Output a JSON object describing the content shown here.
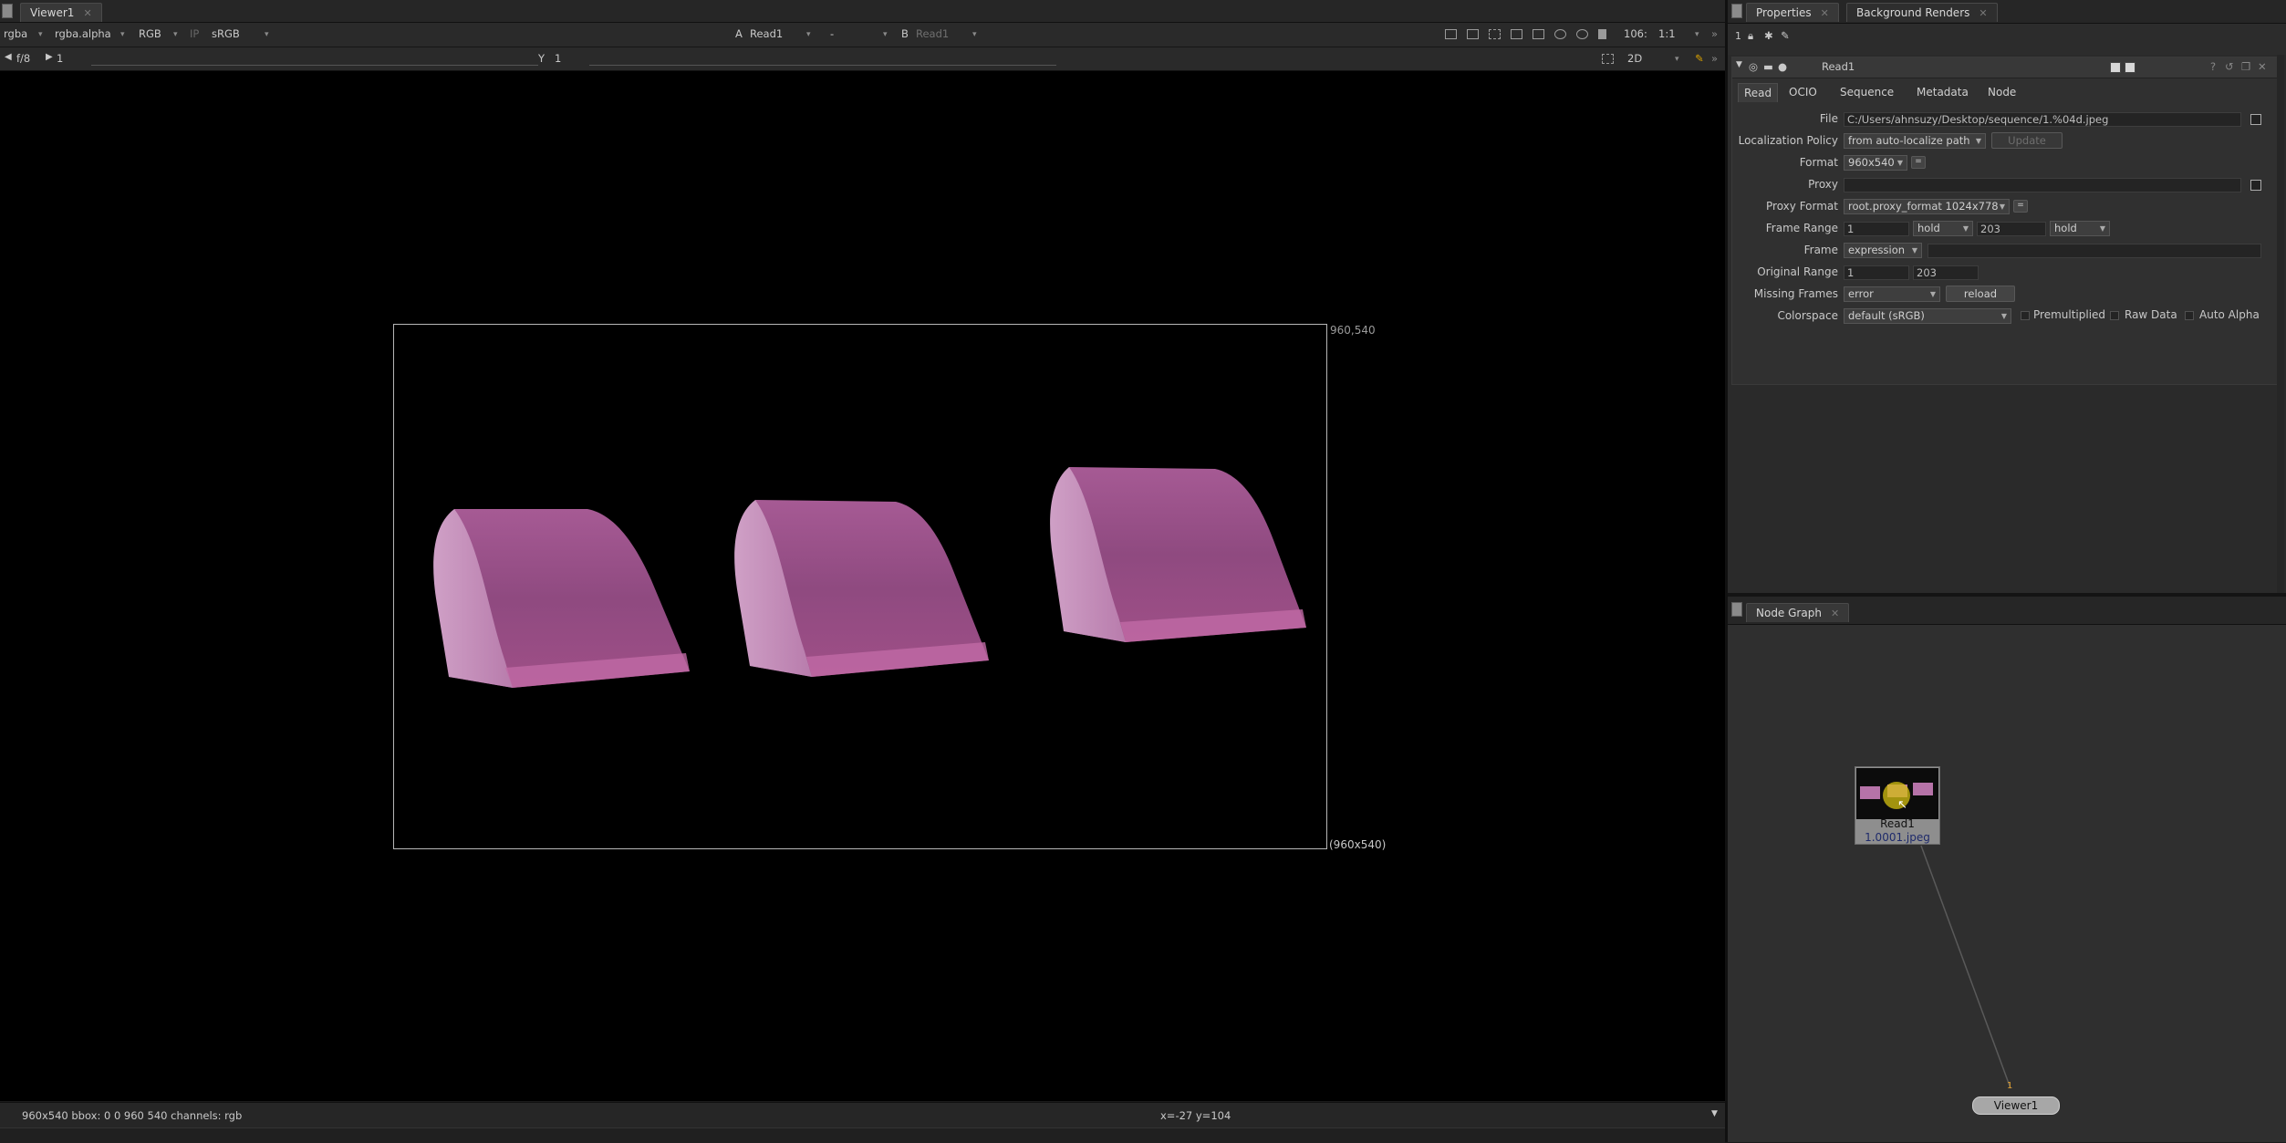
{
  "viewer": {
    "tab_label": "Viewer1",
    "toolbar": {
      "channels": "rgba",
      "alpha_channel": "rgba.alpha",
      "display_channels": "RGB",
      "ip_label": "IP",
      "colorspace": "sRGB",
      "a_label": "A",
      "a_input": "Read1",
      "a_op": "-",
      "b_label": "B",
      "b_input": "Read1",
      "zoom": "106:",
      "proxy": "1:1"
    },
    "toolbar2": {
      "fstop": "f/8",
      "gain_value": "1",
      "y_label": "Y",
      "gamma_value": "1",
      "view_mode": "2D"
    },
    "format_label_top": "960,540",
    "format_label_bottom": "(960x540)",
    "status_left": "960x540  bbox: 0 0 960 540 channels: rgb",
    "status_coords": "x=-27 y=104"
  },
  "properties": {
    "tab_label": "Properties",
    "tab2_label": "Background Renders",
    "node_name": "Read1",
    "tabs": [
      "Read",
      "OCIO",
      "Sequence",
      "Metadata",
      "Node"
    ],
    "file_label": "File",
    "file_value": "C:/Users/ahnsuzy/Desktop/sequence/1.%04d.jpeg",
    "localization_label": "Localization Policy",
    "localization_value": "from auto-localize path",
    "update_label": "Update",
    "format_label": "Format",
    "format_value": "960x540",
    "proxy_label": "Proxy",
    "proxy_format_label": "Proxy Format",
    "proxy_format_value": "root.proxy_format 1024x778",
    "frame_range_label": "Frame Range",
    "frame_range_start": "1",
    "frame_range_before": "hold",
    "frame_range_end": "203",
    "frame_range_after": "hold",
    "frame_label": "Frame",
    "frame_value": "expression",
    "original_range_label": "Original Range",
    "original_range_start": "1",
    "original_range_end": "203",
    "missing_frames_label": "Missing Frames",
    "missing_frames_value": "error",
    "reload_label": "reload",
    "colorspace_label": "Colorspace",
    "colorspace_value": "default (sRGB)",
    "premultiplied_label": "Premultiplied",
    "raw_data_label": "Raw Data",
    "auto_alpha_label": "Auto Alpha",
    "toolbar_num": "1"
  },
  "node_graph": {
    "tab_label": "Node Graph",
    "read_node_label": "Read1",
    "read_node_file": "1.0001.jpeg",
    "viewer_node_label": "Viewer1",
    "viewer_input_number": "1"
  },
  "colors": {
    "viewport_bg": "#000000",
    "panel_bg": "#2a2a2a",
    "node_highlight": "#d4c010",
    "shape_pink": "#b673a8"
  }
}
